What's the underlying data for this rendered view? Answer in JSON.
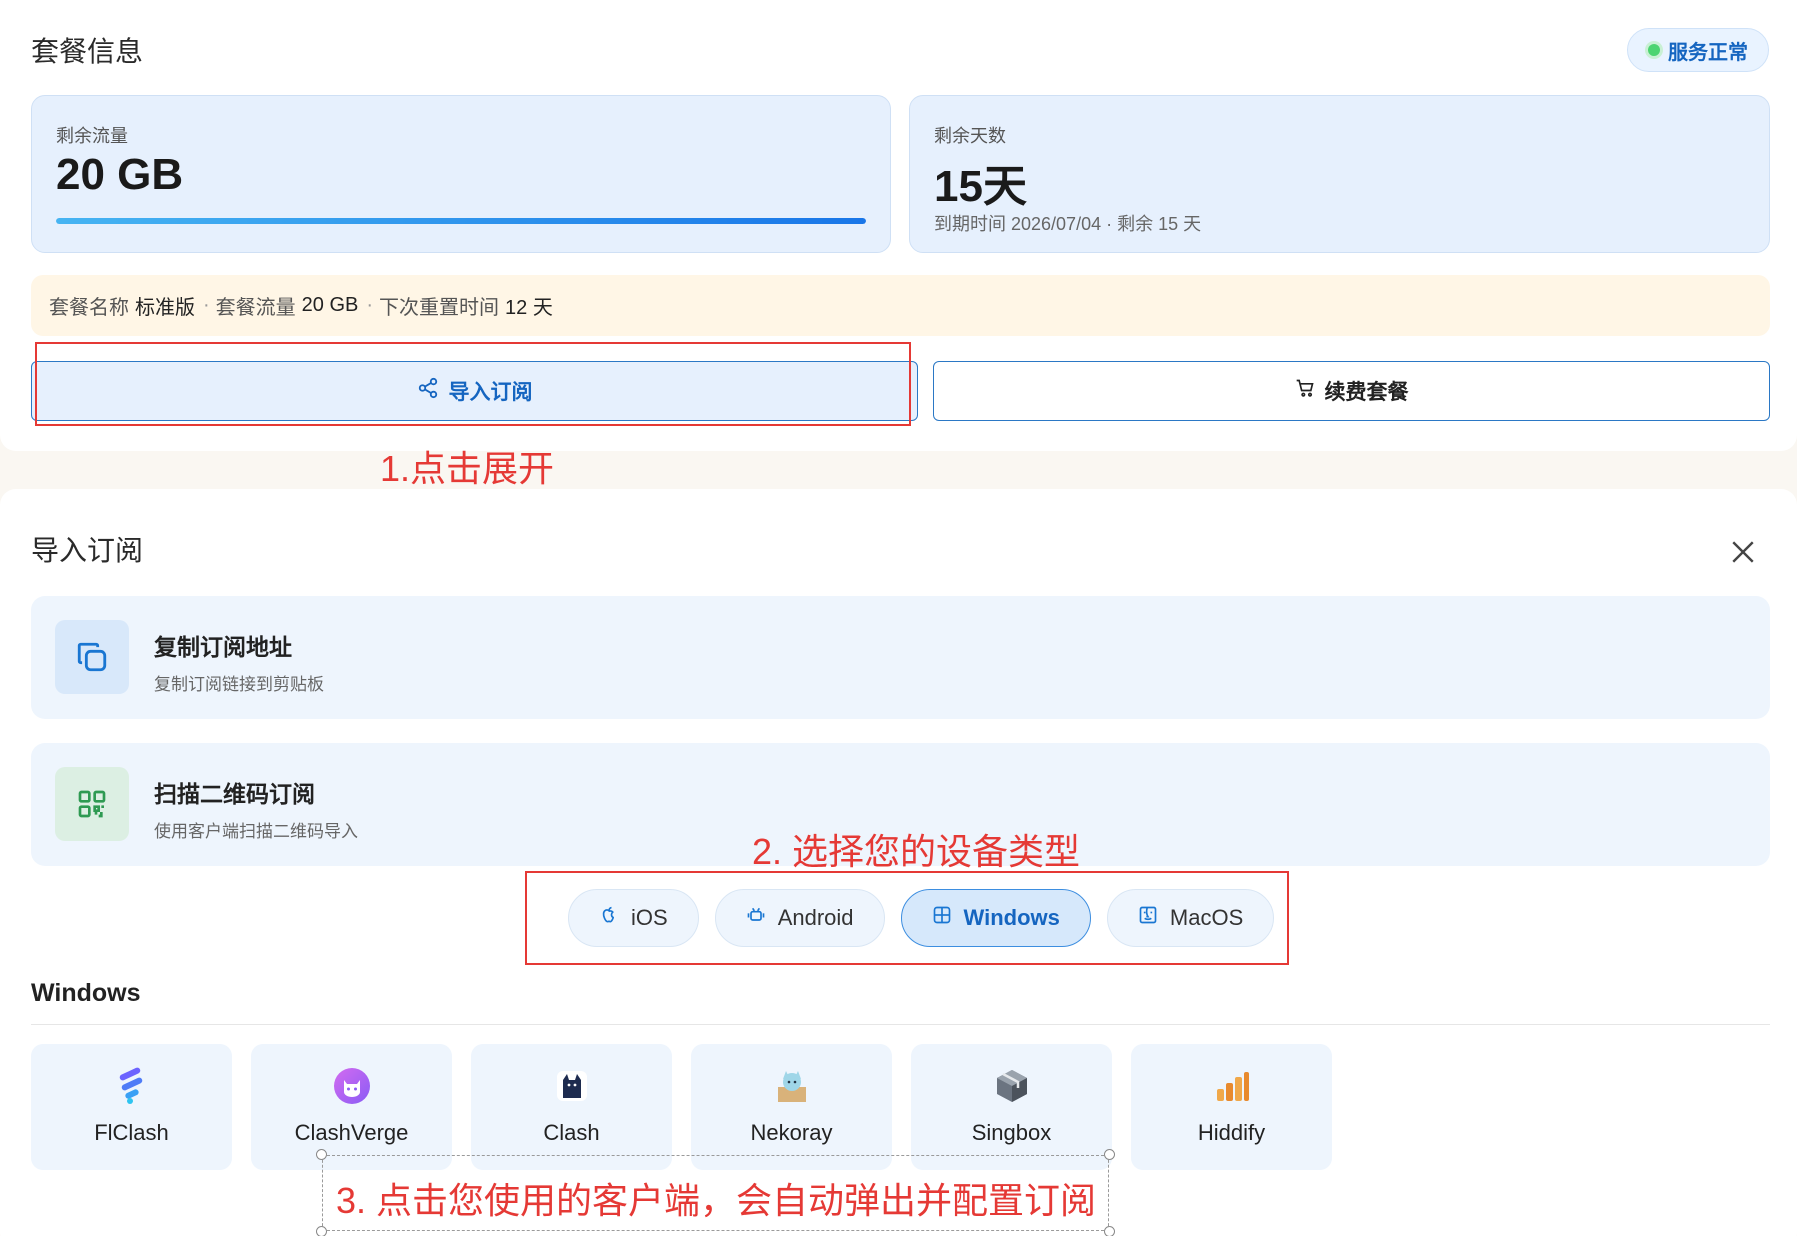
{
  "plan": {
    "title": "套餐信息",
    "status": "服务正常",
    "traffic": {
      "label": "剩余流量",
      "value": "20 GB",
      "progress": 1.0
    },
    "days": {
      "label": "剩余天数",
      "value": "15天",
      "sub": "到期时间 2026/07/04 · 剩余 15 天"
    },
    "info": {
      "name_label": "套餐名称",
      "name_value": "标准版",
      "sep1": "·",
      "traffic_label": "套餐流量",
      "traffic_value": "20 GB",
      "sep2": "·",
      "reset_label": "下次重置时间",
      "reset_value": "12 天"
    },
    "import_button": "导入订阅",
    "renew_button": "续费套餐"
  },
  "annotations": {
    "step1": "1.点击展开",
    "step2": "2. 选择您的设备类型",
    "step3": "3. 点击您使用的客户端，会自动弹出并配置订阅"
  },
  "import": {
    "title": "导入订阅",
    "copy": {
      "title": "复制订阅地址",
      "desc": "复制订阅链接到剪贴板"
    },
    "qr": {
      "title": "扫描二维码订阅",
      "desc": "使用客户端扫描二维码导入"
    },
    "devices": [
      {
        "label": "iOS",
        "icon": "apple-icon",
        "active": false
      },
      {
        "label": "Android",
        "icon": "android-icon",
        "active": false
      },
      {
        "label": "Windows",
        "icon": "windows-icon",
        "active": true
      },
      {
        "label": "MacOS",
        "icon": "macos-icon",
        "active": false
      }
    ],
    "platform_heading": "Windows",
    "clients": [
      {
        "name": "FlClash",
        "icon": "flclash-icon"
      },
      {
        "name": "ClashVerge",
        "icon": "clashverge-icon"
      },
      {
        "name": "Clash",
        "icon": "clash-icon"
      },
      {
        "name": "Nekoray",
        "icon": "nekoray-icon"
      },
      {
        "name": "Singbox",
        "icon": "singbox-icon"
      },
      {
        "name": "Hiddify",
        "icon": "hiddify-icon"
      }
    ]
  },
  "colors": {
    "accent": "#1565c0",
    "annotation": "#e53935",
    "status_dot": "#4cd471",
    "card_blue": "#e6f0fd",
    "info_bar": "#fff6e6"
  }
}
